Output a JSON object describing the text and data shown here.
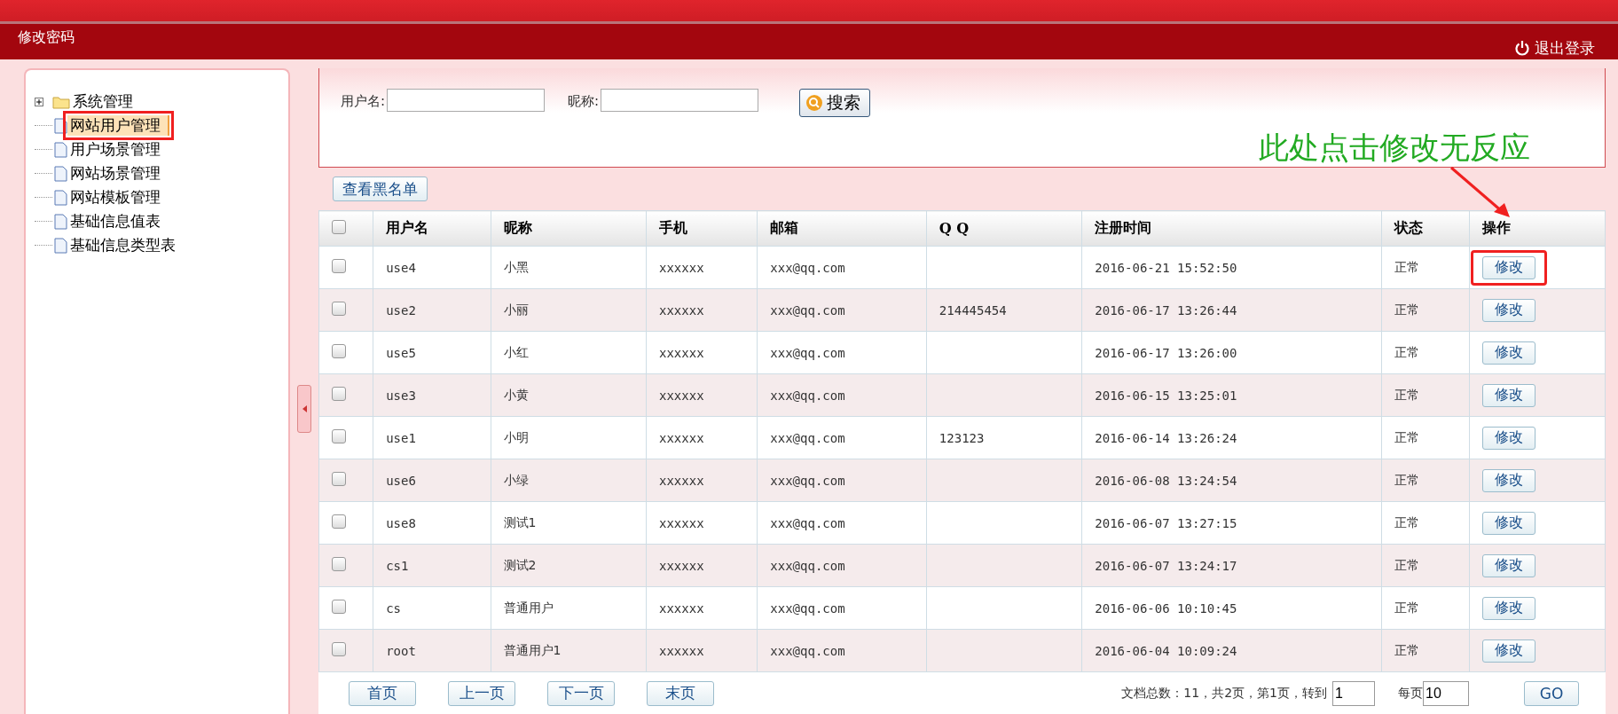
{
  "header": {
    "title": "修改密码",
    "logout": "退出登录"
  },
  "sidebar": {
    "items": [
      {
        "kind": "folder",
        "label": "系统管理",
        "expanded": false,
        "selected": false,
        "highlighted": false
      },
      {
        "kind": "file",
        "label": "网站用户管理",
        "selected": true,
        "highlighted": true
      },
      {
        "kind": "file",
        "label": "用户场景管理",
        "selected": false,
        "highlighted": false
      },
      {
        "kind": "file",
        "label": "网站场景管理",
        "selected": false,
        "highlighted": false
      },
      {
        "kind": "file",
        "label": "网站模板管理",
        "selected": false,
        "highlighted": false
      },
      {
        "kind": "file",
        "label": "基础信息值表",
        "selected": false,
        "highlighted": false
      },
      {
        "kind": "file",
        "label": "基础信息类型表",
        "selected": false,
        "highlighted": false
      }
    ]
  },
  "search": {
    "fields": [
      {
        "label": "用户名:"
      },
      {
        "label": "昵称:"
      }
    ],
    "button": "搜索"
  },
  "annotation": {
    "text": "此处点击修改无反应"
  },
  "toolbar": {
    "button": "查看黑名单"
  },
  "table": {
    "select_all": false,
    "columns": [
      "用户名",
      "昵称",
      "手机",
      "邮箱",
      "Q Q",
      "注册时间",
      "状态",
      "操作"
    ],
    "rows": [
      {
        "checked": false,
        "highlighted": true,
        "cells": [
          "use4",
          "小黑",
          "xxxxxx",
          "xxx@qq.com",
          "",
          "2016-06-21 15:52:50",
          "正常"
        ],
        "action": "修改"
      },
      {
        "checked": false,
        "highlighted": false,
        "cells": [
          "use2",
          "小丽",
          "xxxxxx",
          "xxx@qq.com",
          "214445454",
          "2016-06-17 13:26:44",
          "正常"
        ],
        "action": "修改"
      },
      {
        "checked": false,
        "highlighted": false,
        "cells": [
          "use5",
          "小红",
          "xxxxxx",
          "xxx@qq.com",
          "",
          "2016-06-17 13:26:00",
          "正常"
        ],
        "action": "修改"
      },
      {
        "checked": false,
        "highlighted": false,
        "cells": [
          "use3",
          "小黄",
          "xxxxxx",
          "xxx@qq.com",
          "",
          "2016-06-15 13:25:01",
          "正常"
        ],
        "action": "修改"
      },
      {
        "checked": false,
        "highlighted": false,
        "cells": [
          "use1",
          "小明",
          "xxxxxx",
          "xxx@qq.com",
          "123123",
          "2016-06-14 13:26:24",
          "正常"
        ],
        "action": "修改"
      },
      {
        "checked": false,
        "highlighted": false,
        "cells": [
          "use6",
          "小绿",
          "xxxxxx",
          "xxx@qq.com",
          "",
          "2016-06-08 13:24:54",
          "正常"
        ],
        "action": "修改"
      },
      {
        "checked": false,
        "highlighted": false,
        "cells": [
          "use8",
          "测试1",
          "xxxxxx",
          "xxx@qq.com",
          "",
          "2016-06-07 13:27:15",
          "正常"
        ],
        "action": "修改"
      },
      {
        "checked": false,
        "highlighted": false,
        "cells": [
          "cs1",
          "测试2",
          "xxxxxx",
          "xxx@qq.com",
          "",
          "2016-06-07 13:24:17",
          "正常"
        ],
        "action": "修改"
      },
      {
        "checked": false,
        "highlighted": false,
        "cells": [
          "cs",
          "普通用户",
          "xxxxxx",
          "xxx@qq.com",
          "",
          "2016-06-06 10:10:45",
          "正常"
        ],
        "action": "修改"
      },
      {
        "checked": false,
        "highlighted": false,
        "cells": [
          "root",
          "普通用户1",
          "xxxxxx",
          "xxx@qq.com",
          "",
          "2016-06-04 10:09:24",
          "正常"
        ],
        "action": "修改"
      }
    ]
  },
  "pagination": {
    "buttons": [
      "首页",
      "上一页",
      "下一页",
      "末页"
    ],
    "summary": "文档总数：11，共2页，第1页，转到",
    "page": "1",
    "per_page_label": "每页",
    "per_page": "10",
    "go": "GO"
  }
}
